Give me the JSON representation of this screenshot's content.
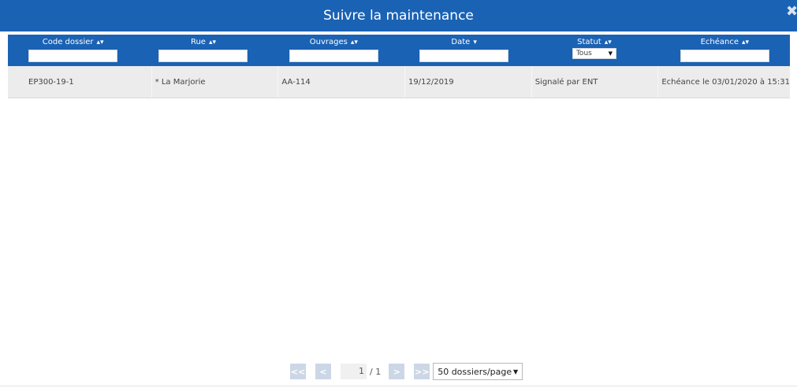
{
  "window": {
    "title": "Suivre la maintenance"
  },
  "icons": {
    "close": "close-icon",
    "sort": "sort-icon",
    "sort_desc": "sort-desc-icon"
  },
  "colors": {
    "header_bg": "#1a62b4",
    "row_bg": "#ececec",
    "pager_btn": "#ccd7e6"
  },
  "table": {
    "columns": [
      {
        "label": "Code dossier",
        "sort": "▴▾",
        "filter": "input",
        "value": ""
      },
      {
        "label": "Rue",
        "sort": "▴▾",
        "filter": "input",
        "value": ""
      },
      {
        "label": "Ouvrages",
        "sort": "▴▾",
        "filter": "input",
        "value": ""
      },
      {
        "label": "Date",
        "sort": "▾",
        "filter": "input",
        "value": ""
      },
      {
        "label": "Statut",
        "sort": "▴▾",
        "filter": "select",
        "value": "Tous"
      },
      {
        "label": "Echéance",
        "sort": "▴▾",
        "filter": "input",
        "value": ""
      }
    ],
    "rows": [
      [
        "EP300-19-1",
        "* La Marjorie",
        "AA-114",
        "19/12/2019",
        "Signalé par ENT",
        "Echéance le 03/01/2020 à 15:31"
      ]
    ]
  },
  "pager": {
    "first": "<<",
    "prev": "<",
    "current_page": "1",
    "total": "/ 1",
    "next": ">",
    "last": ">>",
    "per_page": "50 dossiers/page"
  }
}
